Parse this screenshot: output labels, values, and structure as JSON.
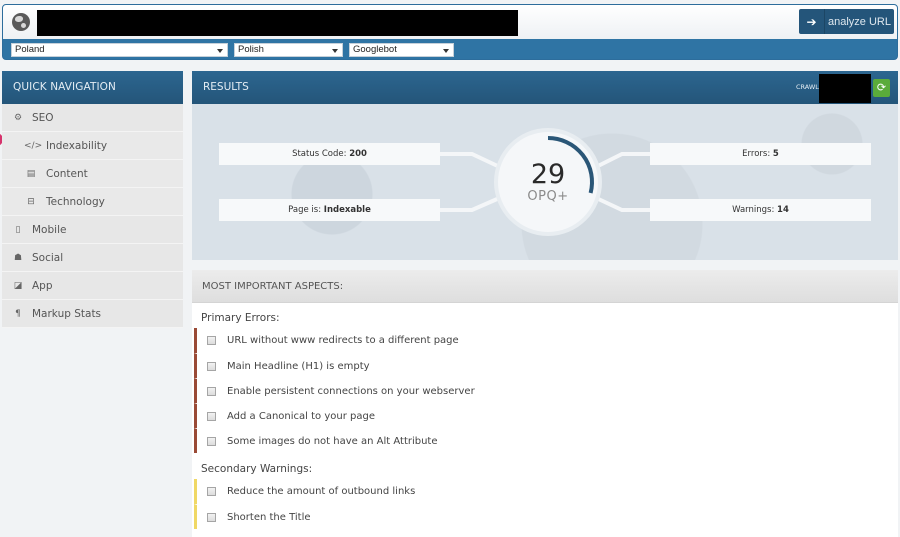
{
  "topbar": {
    "url_value": "",
    "analyze_label": "analyze URL",
    "country": "Poland",
    "language": "Polish",
    "user_agent": "Googlebot"
  },
  "sidebar": {
    "title": "QUICK NAVIGATION",
    "items": [
      {
        "label": "SEO",
        "icon": "dashboard-icon",
        "level": "top"
      },
      {
        "label": "Indexability",
        "icon": "code-icon",
        "level": "sub"
      },
      {
        "label": "Content",
        "icon": "file-icon",
        "level": "sub"
      },
      {
        "label": "Technology",
        "icon": "hdd-icon",
        "level": "sub"
      },
      {
        "label": "Mobile",
        "icon": "mobile-icon",
        "level": "top"
      },
      {
        "label": "Social",
        "icon": "users-icon",
        "level": "top"
      },
      {
        "label": "App",
        "icon": "share-icon",
        "level": "top"
      },
      {
        "label": "Markup Stats",
        "icon": "paragraph-icon",
        "level": "top"
      }
    ]
  },
  "results": {
    "title": "RESULTS",
    "crawled_label": "CRAWLED AT",
    "crawled_value": "",
    "status_label": "Status Code:",
    "status_value": "200",
    "page_label": "Page is:",
    "page_value": "Indexable",
    "errors_label": "Errors:",
    "errors_value": "5",
    "warnings_label": "Warnings:",
    "warnings_value": "14",
    "score": "29",
    "score_label": "OPQ+",
    "score_fraction": 0.29
  },
  "aspects": {
    "title": "MOST IMPORTANT ASPECTS:",
    "primary_title": "Primary Errors:",
    "primary": [
      "URL without www redirects to a different page",
      "Main Headline (H1) is empty",
      "Enable persistent connections on your webserver",
      "Add a Canonical to your page",
      "Some images do not have an Alt Attribute"
    ],
    "secondary_title": "Secondary Warnings:",
    "secondary": [
      "Reduce the amount of outbound links",
      "Shorten the Title"
    ]
  },
  "colors": {
    "header_blue": "#245579",
    "accent_blue": "#2f74a4",
    "refresh_green": "#5aab3a",
    "error_border": "#9a4a36",
    "warning_border": "#f0d865"
  }
}
